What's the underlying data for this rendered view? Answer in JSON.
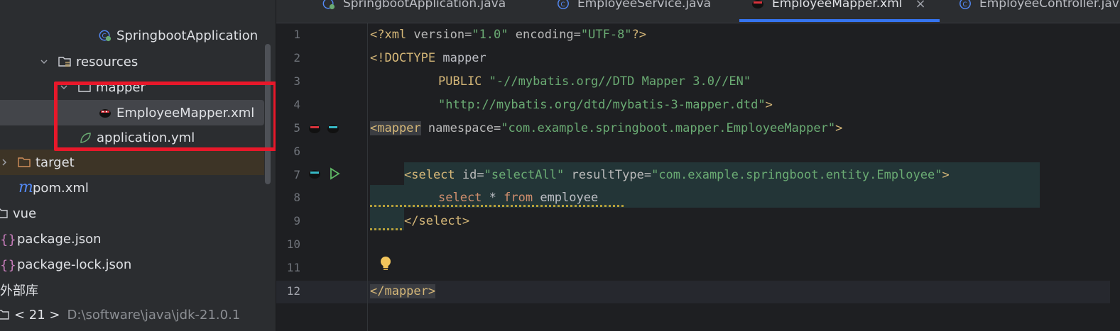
{
  "project_tree": {
    "items": [
      {
        "label": "SpringbootApplication",
        "icon": "spring-class-icon"
      },
      {
        "label": "resources",
        "icon": "resources-folder-icon"
      },
      {
        "label": "mapper",
        "icon": "folder-icon"
      },
      {
        "label": "EmployeeMapper.xml",
        "icon": "mybatis-xml-icon"
      },
      {
        "label": "application.yml",
        "icon": "spring-yml-icon"
      },
      {
        "label": "target",
        "icon": "folder-orange-icon"
      },
      {
        "label": "pom.xml",
        "icon": "maven-icon"
      },
      {
        "label": "vue",
        "icon": "folder-icon"
      },
      {
        "label": "package.json",
        "icon": "json-braces-icon"
      },
      {
        "label": "package-lock.json",
        "icon": "json-braces-icon"
      },
      {
        "label": "外部库",
        "icon": "library-icon"
      },
      {
        "label": "< 21 >",
        "path": "D:\\software\\java\\jdk-21.0.1",
        "icon": "jdk-icon"
      }
    ]
  },
  "tabs": [
    {
      "label": "SpringbootApplication.java",
      "icon": "spring-class-icon"
    },
    {
      "label": "EmployeeService.java",
      "icon": "class-icon"
    },
    {
      "label": "EmployeeMapper.xml",
      "icon": "mybatis-xml-icon",
      "active": true,
      "close": "×"
    },
    {
      "label": "EmployeeController.java",
      "icon": "class-icon"
    }
  ],
  "editor": {
    "line_numbers": [
      "1",
      "2",
      "3",
      "4",
      "5",
      "6",
      "7",
      "8",
      "9",
      "10",
      "11",
      "12"
    ],
    "current_line": "12",
    "lines": {
      "l1": {
        "a": "<?xml ",
        "b": "version",
        "c": "=",
        "d": "\"1.0\"",
        "e": " encoding",
        "f": "=",
        "g": "\"UTF-8\"",
        "h": "?>"
      },
      "l2": {
        "a": "<!DOCTYPE ",
        "b": "mapper"
      },
      "l3": {
        "a": "PUBLIC ",
        "b": "\"-//mybatis.org//DTD Mapper 3.0//EN\""
      },
      "l4": {
        "a": "\"http://mybatis.org/dtd/mybatis-3-mapper.dtd\"",
        "b": ">"
      },
      "l5": {
        "a": "<mapper",
        "b": " namespace",
        "c": "=",
        "d": "\"com.example.springboot.mapper.EmployeeMapper\"",
        "e": ">"
      },
      "l7": {
        "a": "<select ",
        "b": "id",
        "c": "=",
        "d": "\"selectAll\"",
        "e": " resultType",
        "f": "=",
        "g": "\"com.example.springboot.entity.Employee\"",
        "h": ">"
      },
      "l8": {
        "a": "select ",
        "b": "* ",
        "c": "from ",
        "d": "employee"
      },
      "l9": {
        "a": "</select>"
      },
      "l12": {
        "a": "</mapper>"
      }
    }
  },
  "colors": {
    "highlight_box": "#e8182a",
    "active_tab_underline": "#3574f0",
    "sidebar_bg": "#2b2d30",
    "editor_bg": "#1e1f22"
  }
}
